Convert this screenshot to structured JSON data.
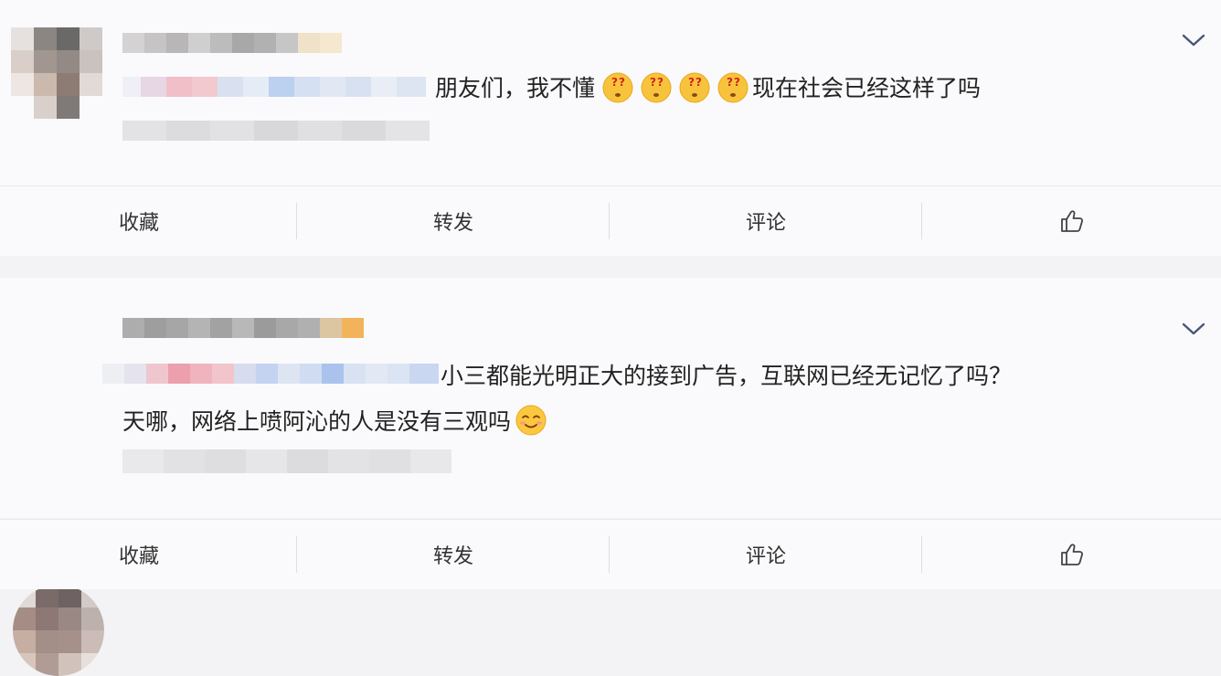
{
  "posts": [
    {
      "comment_text_a": "朋友们，我不懂",
      "comment_text_b": "现在社会已经这样了吗",
      "confused_emoji_count": 4
    },
    {
      "comment_line1": "小三都能光明正大的接到广告，互联网已经无记忆了吗？",
      "comment_line2": "天哪，网络上喷阿沁的人是没有三观吗"
    }
  ],
  "actions": {
    "favorite": "收藏",
    "repost": "转发",
    "comment": "评论"
  },
  "icons": {
    "like": "thumbs-up-icon",
    "expand": "chevron-down-icon",
    "confused_emoji": "confused-face-emoji-icon",
    "smile_emoji": "smiling-face-emoji-icon"
  },
  "colors": {
    "background": "#f3f3f5",
    "card": "#fafafc",
    "text": "#222222"
  }
}
